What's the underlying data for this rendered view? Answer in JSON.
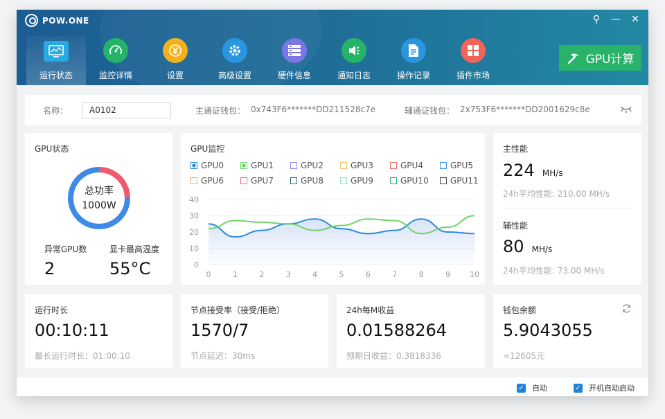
{
  "app": {
    "name": "POW.ONE",
    "controls": [
      "⚲",
      "—",
      "✕"
    ]
  },
  "nav": [
    {
      "label": "运行状态",
      "icon": "monitor-icon",
      "color": "#27a9e1"
    },
    {
      "label": "监控详情",
      "icon": "dashboard-icon",
      "color": "#25b36a"
    },
    {
      "label": "设置",
      "icon": "yen-icon",
      "color": "#f3b21b"
    },
    {
      "label": "高级设置",
      "icon": "gear-icon",
      "color": "#2a96e0"
    },
    {
      "label": "硬件信息",
      "icon": "server-icon",
      "color": "#7a76e8"
    },
    {
      "label": "通知日志",
      "icon": "speaker-icon",
      "color": "#25b36a"
    },
    {
      "label": "操作记录",
      "icon": "document-icon",
      "color": "#2a96e0"
    },
    {
      "label": "插件市场",
      "icon": "grid-icon",
      "color": "#f0645a"
    }
  ],
  "gpu_button": "GPU计算",
  "info": {
    "name_label": "名称：",
    "name_value": "A0102",
    "main_wallet_label": "主通证钱包：",
    "main_wallet": "0x743F6*******DD211528c7e",
    "aux_wallet_label": "辅通证钱包：",
    "aux_wallet": "2x753F6*******DD2001629c8e"
  },
  "gpu_status": {
    "title": "GPU状态",
    "gauge_label": "总功率",
    "gauge_value": "1000W",
    "abnormal_label": "异常GPU数",
    "abnormal_value": "2",
    "temp_label": "显卡最高温度",
    "temp_value": "55°C",
    "gauge_fraction": 0.25
  },
  "monitor": {
    "title": "GPU监控",
    "legend": [
      {
        "name": "GPU0",
        "color": "#2b8ae0",
        "filled": true
      },
      {
        "name": "GPU1",
        "color": "#6fd36a",
        "filled": true
      },
      {
        "name": "GPU2",
        "color": "#8f8cf0",
        "filled": false
      },
      {
        "name": "GPU3",
        "color": "#f2c36b",
        "filled": false
      },
      {
        "name": "GPU4",
        "color": "#ef6b6b",
        "filled": false
      },
      {
        "name": "GPU5",
        "color": "#3e93e8",
        "filled": false
      },
      {
        "name": "GPU6",
        "color": "#f2a36b",
        "filled": false
      },
      {
        "name": "GPU7",
        "color": "#ef6b83",
        "filled": false
      },
      {
        "name": "GPU8",
        "color": "#2a6f7a",
        "filled": false
      },
      {
        "name": "GPU9",
        "color": "#8fe0d0",
        "filled": false
      },
      {
        "name": "GPU10",
        "color": "#27b36a",
        "filled": false
      },
      {
        "name": "GPU11",
        "color": "#444444",
        "filled": false
      }
    ]
  },
  "chart_data": {
    "type": "line",
    "x": [
      0,
      1,
      2,
      3,
      4,
      5,
      6,
      7,
      8,
      9,
      10
    ],
    "xlim": [
      0,
      10
    ],
    "ylim": [
      0,
      40
    ],
    "yticks": [
      0,
      10,
      20,
      30,
      40
    ],
    "series": [
      {
        "name": "GPU0",
        "color": "#2b8ae0",
        "values": [
          25,
          17,
          21,
          25,
          28,
          22,
          19,
          21,
          28,
          20,
          19
        ]
      },
      {
        "name": "GPU1",
        "color": "#6fd36a",
        "values": [
          22,
          27,
          26,
          25,
          21,
          24,
          28,
          27,
          19,
          23,
          30
        ]
      }
    ]
  },
  "main_perf": {
    "title": "主性能",
    "value": "224",
    "unit": "MH/s",
    "avg": "24h平均性能: 210.00 MH/s"
  },
  "aux_perf": {
    "title": "辅性能",
    "value": "80",
    "unit": "MH/s",
    "avg": "24h平均性能: 73.00 MH/s"
  },
  "runtime": {
    "title": "运行时长",
    "value": "00:10:11",
    "sub": "最长运行时长：01:00:10"
  },
  "nodes": {
    "title": "节点接受率（接受/拒绝）",
    "value": "1570/7",
    "sub": "节点延迟：30ms"
  },
  "income": {
    "title": "24h每M收益",
    "value": "0.01588264",
    "sub": "预期日收益：0.3818336"
  },
  "wallet": {
    "title": "钱包余额",
    "value": "5.9043055",
    "sub": "≈12605元"
  },
  "footer": {
    "auto": "自动",
    "autostart": "开机自动启动"
  }
}
